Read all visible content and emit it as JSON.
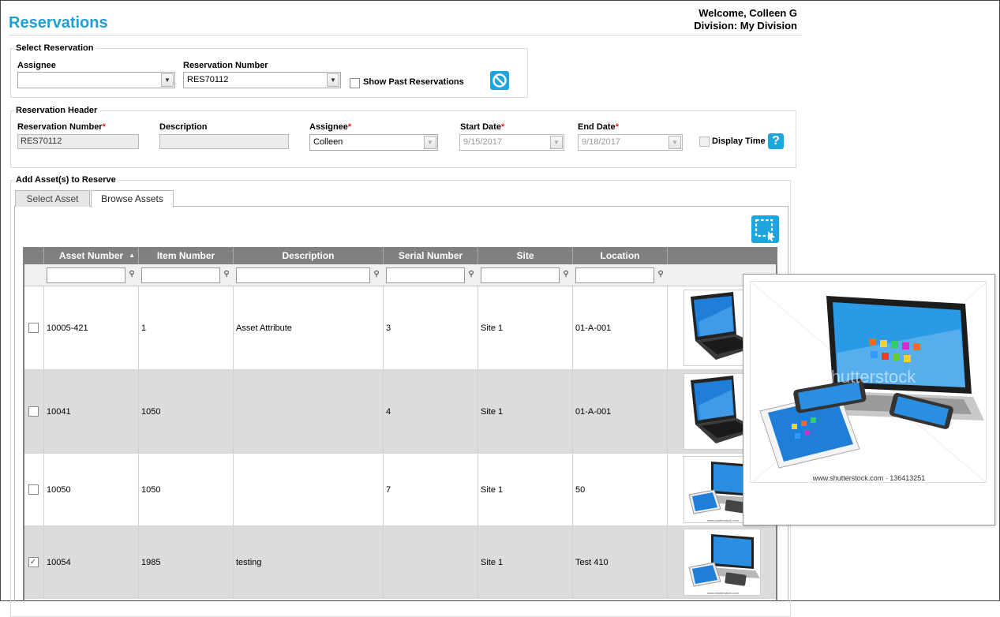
{
  "header": {
    "title": "Reservations",
    "welcome": "Welcome, Colleen G",
    "division": "Division: My Division"
  },
  "select_reservation": {
    "legend": "Select Reservation",
    "assignee_label": "Assignee",
    "assignee_value": "",
    "res_number_label": "Reservation Number",
    "res_number_value": "RES70112",
    "show_past_label": "Show Past Reservations"
  },
  "reservation_header": {
    "legend": "Reservation Header",
    "res_number_label": "Reservation Number",
    "res_number_value": "RES70112",
    "description_label": "Description",
    "description_value": "",
    "assignee_label": "Assignee",
    "assignee_value": "Colleen",
    "start_label": "Start Date",
    "start_value": "9/15/2017",
    "end_label": "End Date",
    "end_value": "9/18/2017",
    "display_time_label": "Display Time",
    "required_mark": "*",
    "help_glyph": "?"
  },
  "add_assets": {
    "legend": "Add Asset(s) to Reserve",
    "tabs": [
      {
        "label": "Select Asset"
      },
      {
        "label": "Browse Assets"
      }
    ]
  },
  "grid": {
    "columns": [
      "Asset Number",
      "Item Number",
      "Description",
      "Serial Number",
      "Site",
      "Location"
    ],
    "sort_indicator": "▲",
    "rows": [
      {
        "checked": false,
        "asset": "10005-421",
        "item": "1",
        "description": "Asset Attribute",
        "serial": "3",
        "site": "Site 1",
        "location": "01-A-001",
        "thumb": "laptop"
      },
      {
        "checked": false,
        "asset": "10041",
        "item": "1050",
        "description": "",
        "serial": "4",
        "site": "Site 1",
        "location": "01-A-001",
        "thumb": "laptop"
      },
      {
        "checked": false,
        "asset": "10050",
        "item": "1050",
        "description": "",
        "serial": "7",
        "site": "Site 1",
        "location": "50",
        "thumb": "devices"
      },
      {
        "checked": true,
        "asset": "10054",
        "item": "1985",
        "description": "testing",
        "serial": "",
        "site": "Site 1",
        "location": "Test 410",
        "thumb": "devices"
      }
    ]
  },
  "popup": {
    "watermark": "shutterstock",
    "caption": "www.shutterstock.com · 136413251"
  },
  "colors": {
    "accent": "#1e9fd6",
    "grid_header": "#808080",
    "row_alt": "#dcdcdc",
    "required": "#e02020"
  }
}
